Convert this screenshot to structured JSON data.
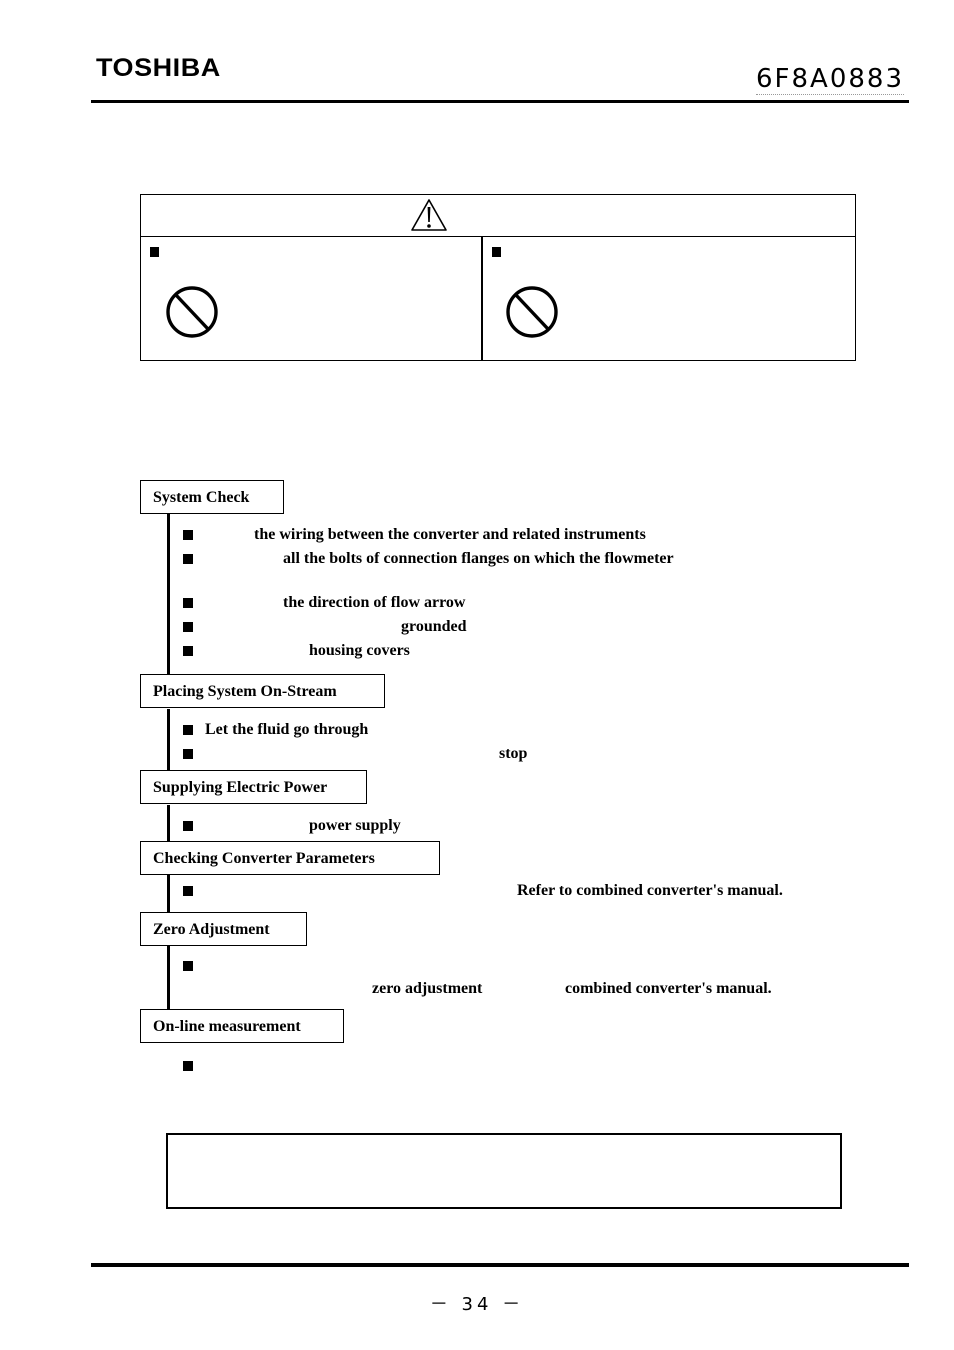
{
  "header": {
    "brand": "TOSHIBA",
    "doc_number": "6F8A0883"
  },
  "caution": {
    "icon": "warning-triangle-icon",
    "left_icon": "prohibition-icon",
    "right_icon": "prohibition-icon"
  },
  "flow": {
    "steps": [
      {
        "title": "System Check",
        "items": [
          "the wiring between the converter and related instruments",
          "all the bolts of connection flanges on which the flowmeter",
          "the direction of flow arrow",
          "grounded",
          "housing covers"
        ]
      },
      {
        "title": "Placing System On-Stream",
        "items": [
          "Let the fluid go through",
          "stop"
        ]
      },
      {
        "title": "Supplying Electric Power",
        "items": [
          "power supply"
        ]
      },
      {
        "title": "Checking Converter Parameters",
        "items": [
          "Refer to combined converter's manual."
        ]
      },
      {
        "title": "Zero Adjustment",
        "items": [
          "zero adjustment",
          "combined converter's manual."
        ]
      },
      {
        "title": "On-line measurement",
        "items": []
      }
    ]
  },
  "footer": {
    "page_number": "－ 34 －"
  }
}
